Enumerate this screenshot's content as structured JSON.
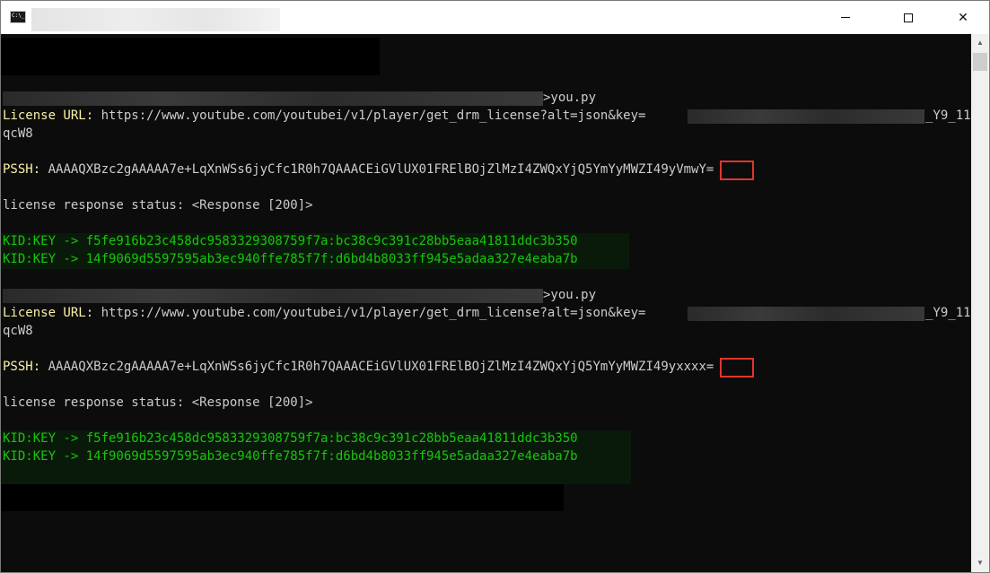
{
  "window": {
    "title": "",
    "controls": {
      "minimize": "minimize",
      "maximize": "maximize",
      "close": "close"
    }
  },
  "console": {
    "runs": [
      {
        "prompt_suffix": ">you.py",
        "license_label": "License URL:",
        "license_url": "https://www.youtube.com/youtubei/v1/player/get_drm_license?alt=json&key=",
        "license_key_tail": "_Y9_11",
        "license_wrap": "qcW8",
        "pssh_label": "PSSH:",
        "pssh_prefix": "AAAAQXBzc2gAAAAA7e+LqXnWSs6jyCfc1R0h7QAAACEiGVlUX01FRElBOjZlMzI4ZWQxYjQ5YmYyMWZI49y",
        "pssh_highlight": "VmwY",
        "pssh_suffix": "=",
        "status": "license response status: <Response [200]>",
        "keys": [
          "KID:KEY -> f5fe916b23c458dc9583329308759f7a:bc38c9c391c28bb5eaa41811ddc3b350",
          "KID:KEY -> 14f9069d5597595ab3ec940ffe785f7f:d6bd4b8033ff945e5adaa327e4eaba7b"
        ]
      },
      {
        "prompt_suffix": ">you.py",
        "license_label": "License URL:",
        "license_url": "https://www.youtube.com/youtubei/v1/player/get_drm_license?alt=json&key=",
        "license_key_tail": "_Y9_11",
        "license_wrap": "qcW8",
        "pssh_label": "PSSH:",
        "pssh_prefix": "AAAAQXBzc2gAAAAA7e+LqXnWSs6jyCfc1R0h7QAAACEiGVlUX01FRElBOjZlMzI4ZWQxYjQ5YmYyMWZI49y",
        "pssh_highlight": "xxxx",
        "pssh_suffix": "=",
        "status": "license response status: <Response [200]>",
        "keys": [
          "KID:KEY -> f5fe916b23c458dc9583329308759f7a:bc38c9c391c28bb5eaa41811ddc3b350",
          "KID:KEY -> 14f9069d5597595ab3ec940ffe785f7f:d6bd4b8033ff945e5adaa327e4eaba7b"
        ]
      }
    ]
  },
  "colors": {
    "background": "#0c0c0c",
    "text": "#cccccc",
    "label_yellow": "#f9f1a5",
    "key_green": "#16c60c",
    "highlight_box": "#e0362c"
  }
}
